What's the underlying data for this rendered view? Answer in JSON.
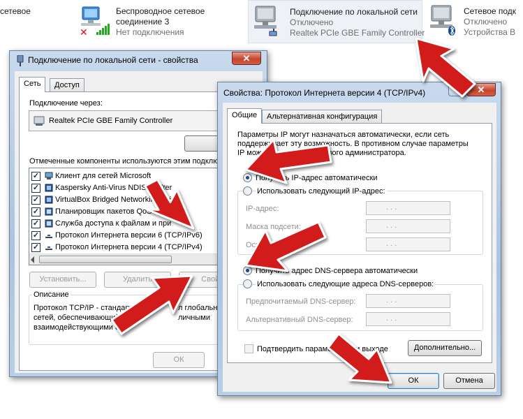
{
  "network_bar": {
    "item0": {
      "line1": "сетевое"
    },
    "item1": {
      "line1": "Беспроводное сетевое",
      "line2": "соединение 3",
      "line3": "Нет подключения"
    },
    "item2": {
      "line1": "Подключение по локальной сети",
      "line2": "Отключено",
      "line3": "Realtek PCIe GBE Family Controller"
    },
    "item3": {
      "line1": "Сетевое подк",
      "line2": "Отключено",
      "line3": "Устройства B"
    }
  },
  "props_window": {
    "title": "Подключение по локальной сети - свойства",
    "close_label": "✕",
    "tabs": [
      "Сеть",
      "Доступ"
    ],
    "connect_using_label": "Подключение через:",
    "adapter": "Realtek PCIe GBE Family Controller",
    "configure_label": "Настро",
    "components_label": "Отмеченные компоненты используются этим подклю",
    "components": [
      {
        "label": "Клиент для сетей Microsoft",
        "checked": true
      },
      {
        "label": "Kaspersky Anti-Virus NDIS 6 Filter",
        "checked": true
      },
      {
        "label": "VirtualBox Bridged Networking Drive",
        "checked": true
      },
      {
        "label": "Планировщик пакетов QoS",
        "checked": true
      },
      {
        "label": "Служба доступа к файлам и при",
        "checked": true
      },
      {
        "label": "Протокол Интернета версии 6 (TCP/IPv6)",
        "checked": true
      },
      {
        "label": "Протокол Интернета версии 4 (TCP/IPv4)",
        "checked": true
      }
    ],
    "install_label": "Установить...",
    "uninstall_label": "Удалить",
    "properties_label": "Свойс",
    "description_title": "Описание",
    "description_lines": [
      "Протокол TCP/IP - стандартный",
      "сетей, обеспечивающий св",
      "взаимодействующими сетя"
    ],
    "description_tail": [
      "л глобальн",
      "личными",
      ""
    ],
    "ok_label": "ОК"
  },
  "ipv4_window": {
    "title": "Свойства: Протокол Интернета версии 4 (TCP/IPv4)",
    "help_label": "?",
    "close_label": "✕",
    "tabs": [
      "Общие",
      "Альтернативная конфигурация"
    ],
    "intro_lines": [
      "Параметры IP могут назначаться автоматически, если сеть",
      "поддерживает эту возможность. В противном случае параметры",
      "IP можно получить у сетевого администратора."
    ],
    "auto_ip_label": "Получить IP-адрес автоматически",
    "manual_ip_label": "Использовать следующий IP-адрес:",
    "ip_address_label": "IP-адрес:",
    "subnet_label": "Маска подсети:",
    "gateway_label": "Основной шлюз:",
    "auto_dns_label": "Получить адрес DNS-сервера автоматически",
    "manual_dns_label": "Использовать следующие адреса DNS-серверов:",
    "preferred_dns_label": "Предпочитаемый DNS-сервер:",
    "alternate_dns_label": "Альтернативный DNS-сервер:",
    "ip_placeholder": ".    .    .",
    "validate_label": "Подтвердить параметры при выходе",
    "advanced_label": "Дополнительно...",
    "ok_label": "ОК",
    "cancel_label": "Отмена",
    "auto_ip_selected": true,
    "auto_dns_selected": true
  },
  "colors": {
    "arrow_red": "#d21c1c",
    "selection_blue": "#3399ff",
    "accent": "#3c7fb1"
  }
}
